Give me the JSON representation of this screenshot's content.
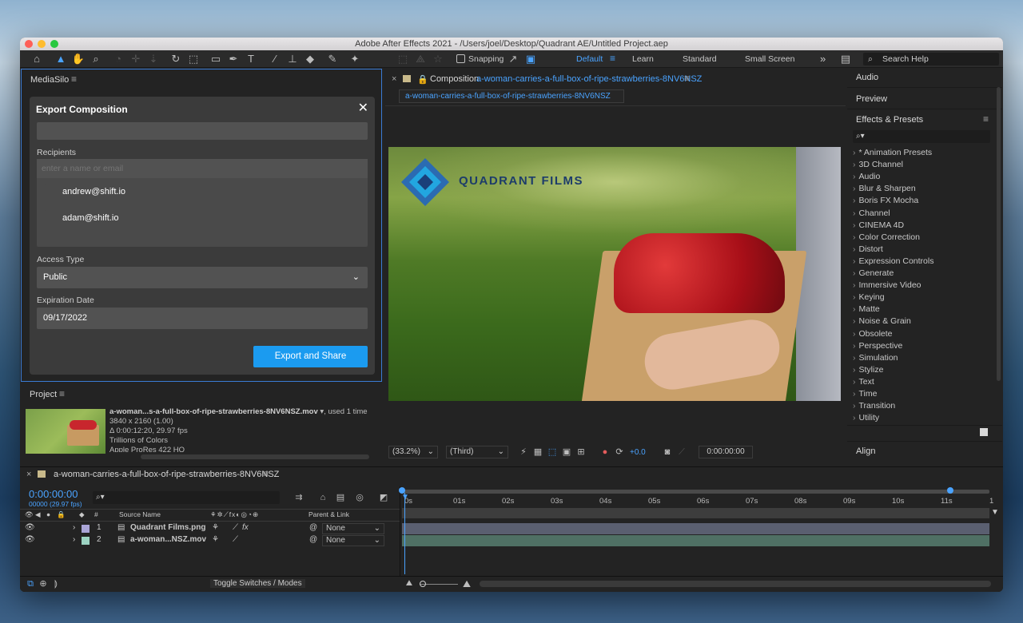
{
  "window": {
    "title": "Adobe After Effects 2021 - /Users/joel/Desktop/Quadrant AE/Untitled Project.aep"
  },
  "toolbar": {
    "snapping_label": "Snapping",
    "workspaces": [
      "Default",
      "Learn",
      "Standard",
      "Small Screen"
    ],
    "active_workspace": "Default",
    "search_placeholder": "Search Help"
  },
  "mediasilo": {
    "panel_title": "MediaSilo",
    "dialog": {
      "title": "Export Composition",
      "recipients_label": "Recipients",
      "recipients_placeholder": "enter a name or email",
      "recipients": [
        "andrew@shift.io",
        "adam@shift.io"
      ],
      "access_type_label": "Access Type",
      "access_type_value": "Public",
      "expiration_label": "Expiration Date",
      "expiration_value": "09/17/2022",
      "export_button": "Export and Share"
    }
  },
  "composition": {
    "tab_prefix": "Composition",
    "tab_name": "a-woman-carries-a-full-box-of-ripe-strawberries-8NV6NSZ",
    "sub_tab": "a-woman-carries-a-full-box-of-ripe-strawberries-8NV6NSZ",
    "logo_text": "QUADRANT FILMS",
    "zoom": "(33.2%)",
    "resolution": "(Third)",
    "exposure": "+0.0",
    "timecode": "0:00:00:00"
  },
  "project": {
    "panel_title": "Project",
    "filename": "a-woman...s-a-full-box-of-ripe-strawberries-8NV6NSZ.mov",
    "used": ", used 1 time",
    "details": [
      "3840 x 2160 (1.00)",
      "Δ 0:00:12:20, 29.97 fps",
      "Trillions of Colors",
      "Apple ProRes 422 HQ"
    ]
  },
  "effects": {
    "audio_tab": "Audio",
    "preview_tab": "Preview",
    "panel_title": "Effects & Presets",
    "search_icon_label": "⌕▾",
    "items": [
      "* Animation Presets",
      "3D Channel",
      "Audio",
      "Blur & Sharpen",
      "Boris FX Mocha",
      "Channel",
      "CINEMA 4D",
      "Color Correction",
      "Distort",
      "Expression Controls",
      "Generate",
      "Immersive Video",
      "Keying",
      "Matte",
      "Noise & Grain",
      "Obsolete",
      "Perspective",
      "Simulation",
      "Stylize",
      "Text",
      "Time",
      "Transition",
      "Utility"
    ],
    "align_tab": "Align"
  },
  "timeline": {
    "tab_name": "a-woman-carries-a-full-box-of-ripe-strawberries-8NV6NSZ",
    "timecode": "0:00:00:00",
    "fps": "00000 (29.97 fps)",
    "headers": {
      "num": "#",
      "source_name": "Source Name",
      "parent_link": "Parent & Link"
    },
    "layers": [
      {
        "num": "1",
        "name": "Quadrant Films.png",
        "parent": "None",
        "fx": "fx",
        "color": "#a9a4d6"
      },
      {
        "num": "2",
        "name": "a-woman...NSZ.mov",
        "parent": "None",
        "fx": "",
        "color": "#9cd3c2"
      }
    ],
    "ruler": [
      "0s",
      "01s",
      "02s",
      "03s",
      "04s",
      "05s",
      "06s",
      "07s",
      "08s",
      "09s",
      "10s",
      "11s",
      "1"
    ],
    "toggle_label": "Toggle Switches / Modes"
  },
  "colors": {
    "accent": "#4aa3ff",
    "button_blue": "#1b9bf0",
    "panel_bg": "#232323",
    "selection_border": "#3a7bd5"
  }
}
